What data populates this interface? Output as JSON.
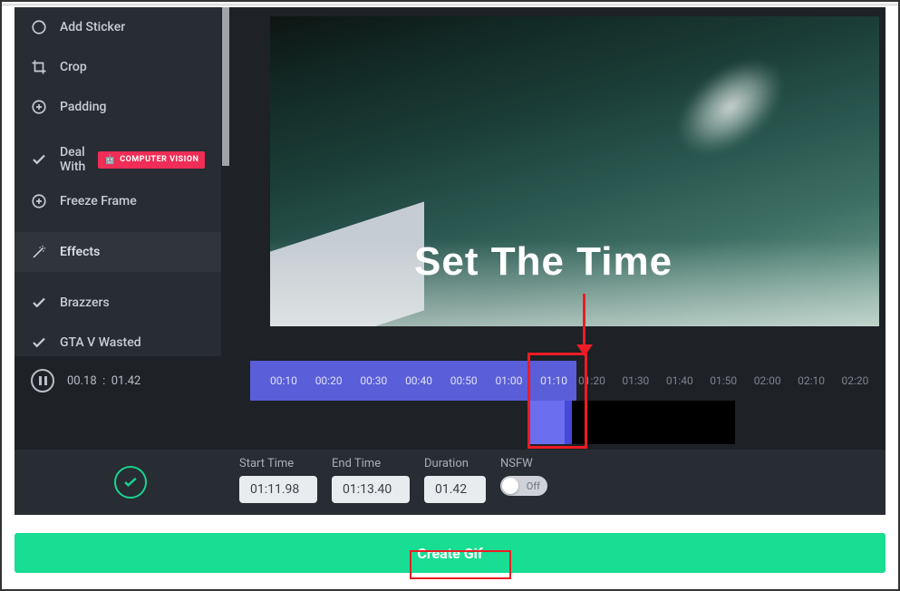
{
  "sidebar": {
    "items": [
      {
        "label": "Add Sticker",
        "icon": "sticker-icon"
      },
      {
        "label": "Crop",
        "icon": "crop-icon"
      },
      {
        "label": "Padding",
        "icon": "plus-circle-icon"
      },
      {
        "label": "Deal With",
        "icon": "check-icon",
        "badge": "COMPUTER VISION"
      },
      {
        "label": "Freeze Frame",
        "icon": "plus-circle-icon"
      }
    ],
    "section": {
      "label": "Effects",
      "icon": "wand-icon"
    },
    "items2": [
      {
        "label": "Brazzers",
        "icon": "check-icon"
      },
      {
        "label": "GTA V Wasted",
        "icon": "check-icon"
      }
    ]
  },
  "player": {
    "current": "00.18",
    "total": "01.42"
  },
  "ticks": [
    "00:10",
    "00:20",
    "00:30",
    "00:40",
    "00:50",
    "01:00",
    "01:10",
    "01:20",
    "01:30",
    "01:40",
    "01:50",
    "02:00",
    "02:10",
    "02:20"
  ],
  "controls": {
    "start": {
      "label": "Start Time",
      "value": "01:11.98"
    },
    "end": {
      "label": "End Time",
      "value": "01:13.40"
    },
    "dur": {
      "label": "Duration",
      "value": "01.42"
    },
    "nsfw": {
      "label": "NSFW",
      "state": "Off"
    }
  },
  "cta": "Create Gif",
  "annotation": {
    "title": "Set The Time"
  }
}
